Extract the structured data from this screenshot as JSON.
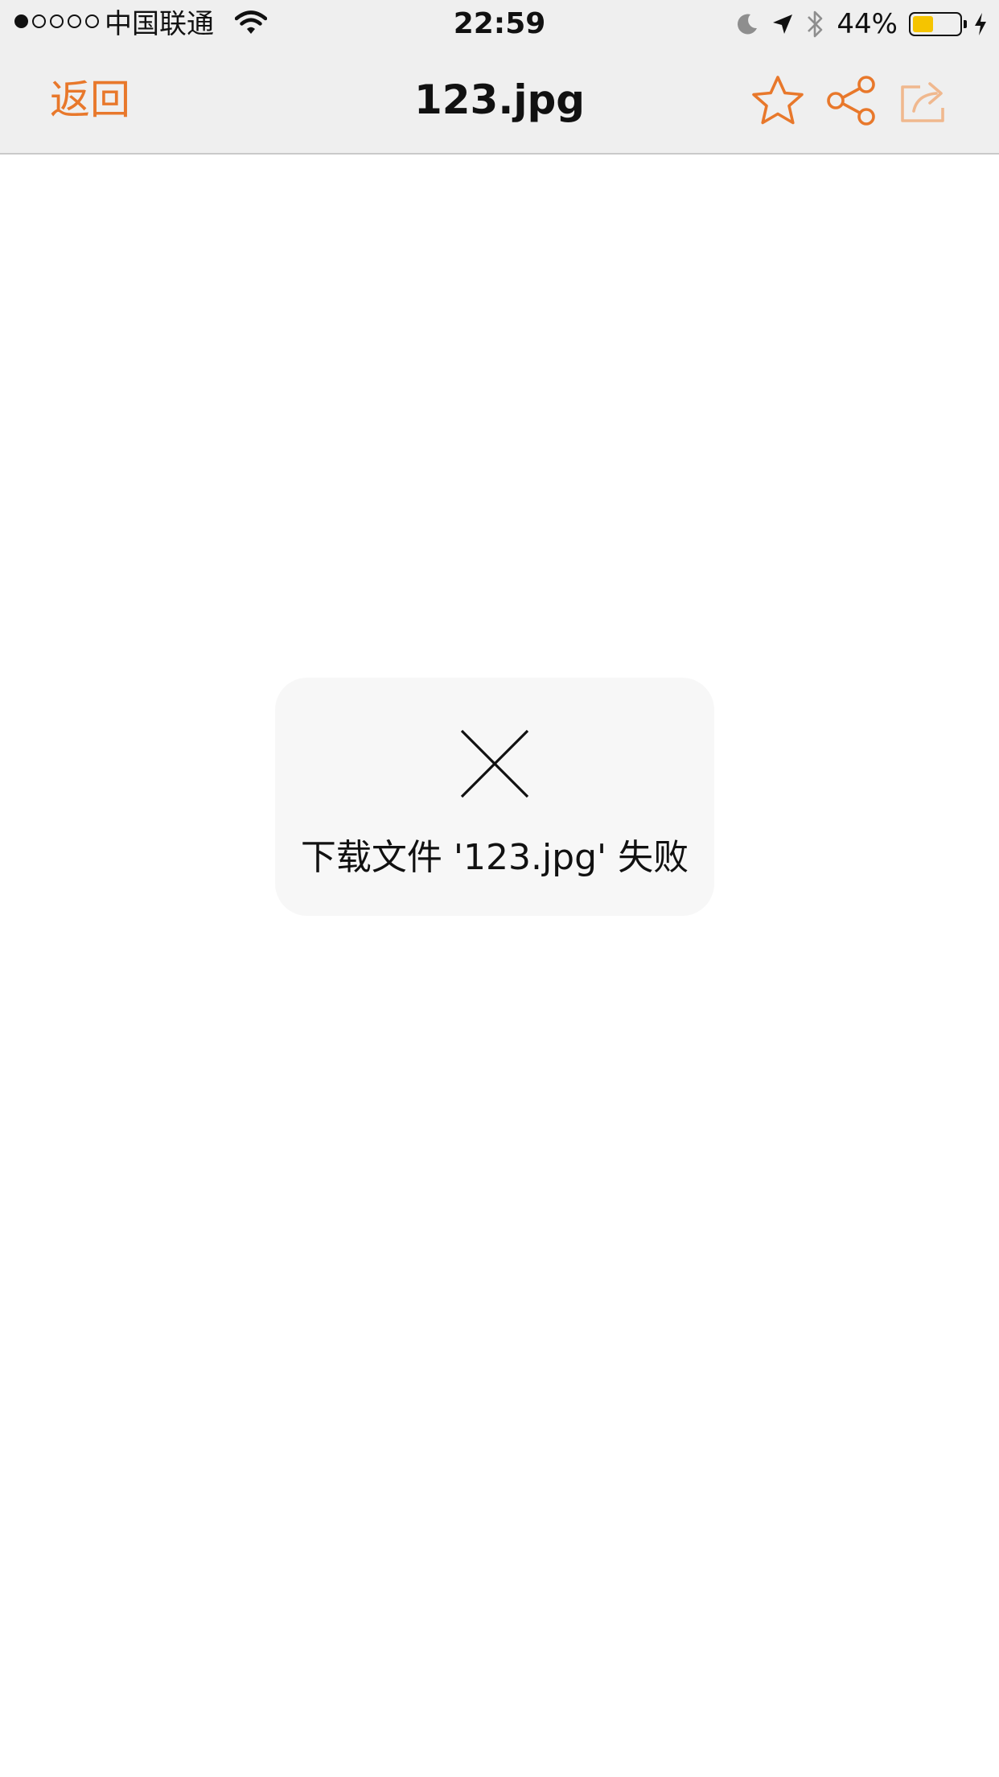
{
  "status_bar": {
    "carrier": "中国联通",
    "time": "22:59",
    "battery_percent": "44%",
    "battery_level": 0.44,
    "signal_bars_total": 5,
    "signal_bars_filled": 1
  },
  "nav": {
    "back_label": "返回",
    "title": "123.jpg",
    "icons": [
      "star-icon",
      "share-nodes-icon",
      "forward-share-icon"
    ]
  },
  "toast": {
    "icon": "close-icon",
    "message": "下载文件 '123.jpg' 失败"
  },
  "colors": {
    "accent": "#e8782b",
    "accent_faded": "#f0b88e",
    "bar_background": "#efefef",
    "toast_background": "#f7f7f7",
    "battery_fill": "#f5c400"
  }
}
